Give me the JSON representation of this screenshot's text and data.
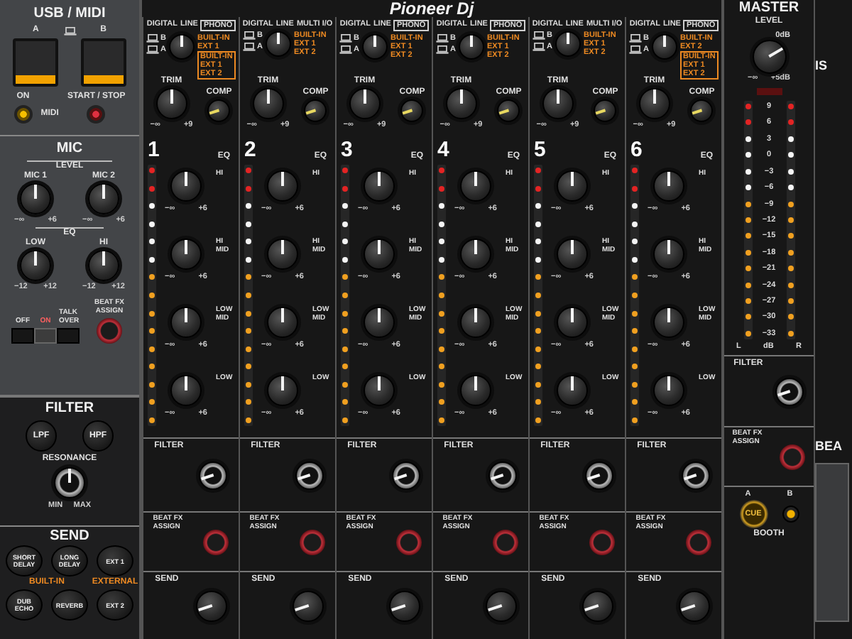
{
  "logo": "Pioneer Dj",
  "usb_midi": {
    "title": "USB / MIDI",
    "deck_buttons": [
      {
        "label": "A",
        "lit": true
      },
      {
        "label": "B",
        "lit": true
      }
    ],
    "on_label": "ON",
    "midi_label": "MIDI",
    "start_stop_label": "START / STOP"
  },
  "mic": {
    "title": "MIC",
    "level_label": "LEVEL",
    "eq_label": "EQ",
    "level_knobs": [
      {
        "label": "MIC 1",
        "min": "−∞",
        "max": "+6",
        "level": 0.5
      },
      {
        "label": "MIC 2",
        "min": "−∞",
        "max": "+6",
        "level": 0.5
      }
    ],
    "eq_knobs": [
      {
        "label": "LOW",
        "min": "−12",
        "max": "+12",
        "level": 0.5
      },
      {
        "label": "HI",
        "min": "−12",
        "max": "+12",
        "level": 0.5
      }
    ],
    "switch": [
      {
        "label": "OFF",
        "selected": false
      },
      {
        "label": "ON",
        "selected": true
      },
      {
        "label": "TALK OVER",
        "selected": false
      }
    ],
    "beat_fx_label": "BEAT FX ASSIGN"
  },
  "filter": {
    "title": "FILTER",
    "buttons": [
      "LPF",
      "HPF"
    ],
    "resonance": {
      "label": "RESONANCE",
      "min": "MIN",
      "max": "MAX",
      "level": 0.5
    }
  },
  "send": {
    "title": "SEND",
    "built_in_label": "BUILT-IN",
    "external_label": "EXTERNAL",
    "buttons": [
      "SHORT DELAY",
      "LONG DELAY",
      "EXT 1",
      "DUB ECHO",
      "REVERB",
      "EXT 2"
    ]
  },
  "channels": [
    {
      "number": "1",
      "inputs": {
        "top": [
          {
            "label": "DIGITAL",
            "boxed": false
          },
          {
            "label": "LINE",
            "boxed": false
          },
          {
            "label": "PHONO",
            "boxed": true
          }
        ],
        "left": [
          "B",
          "A"
        ],
        "right": [
          "BUILT-IN",
          "EXT 1"
        ],
        "boxed": [
          "BUILT-IN",
          "EXT 1",
          "EXT 2"
        ]
      },
      "selector": {
        "level": 0.5
      },
      "trim": {
        "label": "TRIM",
        "min": "−∞",
        "max": "+9",
        "level": 0.5
      },
      "comp": {
        "label": "COMP",
        "level": 0.1
      },
      "eq_label": "EQ",
      "eq": [
        {
          "label": "HI",
          "min": "−∞",
          "max": "+6",
          "level": 0.5
        },
        {
          "label": "HI MID",
          "min": "−∞",
          "max": "+6",
          "level": 0.5
        },
        {
          "label": "LOW MID",
          "min": "−∞",
          "max": "+6",
          "level": 0.5
        },
        {
          "label": "LOW",
          "min": "−∞",
          "max": "+6",
          "level": 0.5
        }
      ],
      "meter": {
        "level": 1
      },
      "filter": {
        "label": "FILTER",
        "level": 0.1
      },
      "beat_fx_label": "BEAT FX ASSIGN",
      "send": {
        "label": "SEND",
        "level": 0.1
      }
    },
    {
      "number": "2",
      "inputs": {
        "top": [
          {
            "label": "DIGITAL",
            "boxed": false
          },
          {
            "label": "LINE",
            "boxed": false
          },
          {
            "label": "MULTI I/O",
            "boxed": false
          }
        ],
        "left": [
          "B",
          "A"
        ],
        "right": [
          "BUILT-IN",
          "EXT 1",
          "EXT 2"
        ]
      },
      "selector": {
        "level": 0.5
      },
      "trim": {
        "label": "TRIM",
        "min": "−∞",
        "max": "+9",
        "level": 0.5
      },
      "comp": {
        "label": "COMP",
        "level": 0.1
      },
      "eq_label": "EQ",
      "eq": [
        {
          "label": "HI",
          "min": "−∞",
          "max": "+6",
          "level": 0.5
        },
        {
          "label": "HI MID",
          "min": "−∞",
          "max": "+6",
          "level": 0.5
        },
        {
          "label": "LOW MID",
          "min": "−∞",
          "max": "+6",
          "level": 0.5
        },
        {
          "label": "LOW",
          "min": "−∞",
          "max": "+6",
          "level": 0.5
        }
      ],
      "meter": {
        "level": 1
      },
      "filter": {
        "label": "FILTER",
        "level": 0.1
      },
      "beat_fx_label": "BEAT FX ASSIGN",
      "send": {
        "label": "SEND",
        "level": 0.1
      }
    },
    {
      "number": "3",
      "inputs": {
        "top": [
          {
            "label": "DIGITAL",
            "boxed": false
          },
          {
            "label": "LINE",
            "boxed": false
          },
          {
            "label": "PHONO",
            "boxed": true
          }
        ],
        "left": [
          "B",
          "A"
        ],
        "right": [
          "BUILT-IN",
          "EXT 1",
          "EXT 2"
        ]
      },
      "selector": {
        "level": 0.5
      },
      "trim": {
        "label": "TRIM",
        "min": "−∞",
        "max": "+9",
        "level": 0.5
      },
      "comp": {
        "label": "COMP",
        "level": 0.1
      },
      "eq_label": "EQ",
      "eq": [
        {
          "label": "HI",
          "min": "−∞",
          "max": "+6",
          "level": 0.5
        },
        {
          "label": "HI MID",
          "min": "−∞",
          "max": "+6",
          "level": 0.5
        },
        {
          "label": "LOW MID",
          "min": "−∞",
          "max": "+6",
          "level": 0.5
        },
        {
          "label": "LOW",
          "min": "−∞",
          "max": "+6",
          "level": 0.5
        }
      ],
      "meter": {
        "level": 1
      },
      "filter": {
        "label": "FILTER",
        "level": 0.1
      },
      "beat_fx_label": "BEAT FX ASSIGN",
      "send": {
        "label": "SEND",
        "level": 0.1
      }
    },
    {
      "number": "4",
      "inputs": {
        "top": [
          {
            "label": "DIGITAL",
            "boxed": false
          },
          {
            "label": "LINE",
            "boxed": false
          },
          {
            "label": "PHONO",
            "boxed": true
          }
        ],
        "left": [
          "B",
          "A"
        ],
        "right": [
          "BUILT-IN",
          "EXT 1",
          "EXT 2"
        ]
      },
      "selector": {
        "level": 0.5
      },
      "trim": {
        "label": "TRIM",
        "min": "−∞",
        "max": "+9",
        "level": 0.5
      },
      "comp": {
        "label": "COMP",
        "level": 0.1
      },
      "eq_label": "EQ",
      "eq": [
        {
          "label": "HI",
          "min": "−∞",
          "max": "+6",
          "level": 0.5
        },
        {
          "label": "HI MID",
          "min": "−∞",
          "max": "+6",
          "level": 0.5
        },
        {
          "label": "LOW MID",
          "min": "−∞",
          "max": "+6",
          "level": 0.5
        },
        {
          "label": "LOW",
          "min": "−∞",
          "max": "+6",
          "level": 0.5
        }
      ],
      "meter": {
        "level": 1
      },
      "filter": {
        "label": "FILTER",
        "level": 0.1
      },
      "beat_fx_label": "BEAT FX ASSIGN",
      "send": {
        "label": "SEND",
        "level": 0.1
      }
    },
    {
      "number": "5",
      "inputs": {
        "top": [
          {
            "label": "DIGITAL",
            "boxed": false
          },
          {
            "label": "LINE",
            "boxed": false
          },
          {
            "label": "MULTI I/O",
            "boxed": false
          }
        ],
        "left": [
          "B",
          "A"
        ],
        "right": [
          "BUILT-IN",
          "EXT 1",
          "EXT 2"
        ]
      },
      "selector": {
        "level": 0.5
      },
      "trim": {
        "label": "TRIM",
        "min": "−∞",
        "max": "+9",
        "level": 0.5
      },
      "comp": {
        "label": "COMP",
        "level": 0.1
      },
      "eq_label": "EQ",
      "eq": [
        {
          "label": "HI",
          "min": "−∞",
          "max": "+6",
          "level": 0.5
        },
        {
          "label": "HI MID",
          "min": "−∞",
          "max": "+6",
          "level": 0.5
        },
        {
          "label": "LOW MID",
          "min": "−∞",
          "max": "+6",
          "level": 0.5
        },
        {
          "label": "LOW",
          "min": "−∞",
          "max": "+6",
          "level": 0.5
        }
      ],
      "meter": {
        "level": 1
      },
      "filter": {
        "label": "FILTER",
        "level": 0.1
      },
      "beat_fx_label": "BEAT FX ASSIGN",
      "send": {
        "label": "SEND",
        "level": 0.1
      }
    },
    {
      "number": "6",
      "inputs": {
        "top": [
          {
            "label": "DIGITAL",
            "boxed": false
          },
          {
            "label": "LINE",
            "boxed": false
          },
          {
            "label": "PHONO",
            "boxed": true
          }
        ],
        "left": [
          "B",
          "A"
        ],
        "right": [
          "BUILT-IN",
          "EXT 2"
        ],
        "boxed": [
          "BUILT-IN",
          "EXT 1",
          "EXT 2"
        ]
      },
      "selector": {
        "level": 0.5
      },
      "trim": {
        "label": "TRIM",
        "min": "−∞",
        "max": "+9",
        "level": 0.5
      },
      "comp": {
        "label": "COMP",
        "level": 0.1
      },
      "eq_label": "EQ",
      "eq": [
        {
          "label": "HI",
          "min": "−∞",
          "max": "+6",
          "level": 0.5
        },
        {
          "label": "HI MID",
          "min": "−∞",
          "max": "+6",
          "level": 0.5
        },
        {
          "label": "LOW MID",
          "min": "−∞",
          "max": "+6",
          "level": 0.5
        },
        {
          "label": "LOW",
          "min": "−∞",
          "max": "+6",
          "level": 0.5
        }
      ],
      "meter": {
        "level": 1
      },
      "filter": {
        "label": "FILTER",
        "level": 0.1
      },
      "beat_fx_label": "BEAT FX ASSIGN",
      "send": {
        "label": "SEND",
        "level": 0.1
      }
    }
  ],
  "master": {
    "title": "MASTER",
    "level_label": "LEVEL",
    "level_knob": {
      "min": "−∞",
      "mid": "0dB",
      "max": "+5dB",
      "level": 0.72
    },
    "meter": {
      "level": 1,
      "scale": [
        "9",
        "6",
        "3",
        "0",
        "−3",
        "−6",
        "−9",
        "−12",
        "−15",
        "−18",
        "−21",
        "−24",
        "−27",
        "−30",
        "−33"
      ],
      "left_label": "L",
      "unit_label": "dB",
      "right_label": "R"
    },
    "filter": {
      "label": "FILTER",
      "level": 0.1
    },
    "beat_fx_label": "BEAT FX ASSIGN",
    "cue": {
      "label": "CUE",
      "a_label": "A",
      "b_label": "B"
    },
    "booth_label": "BOOTH"
  },
  "edge": {
    "top_label": "IS",
    "bottom_label": "BEA"
  }
}
